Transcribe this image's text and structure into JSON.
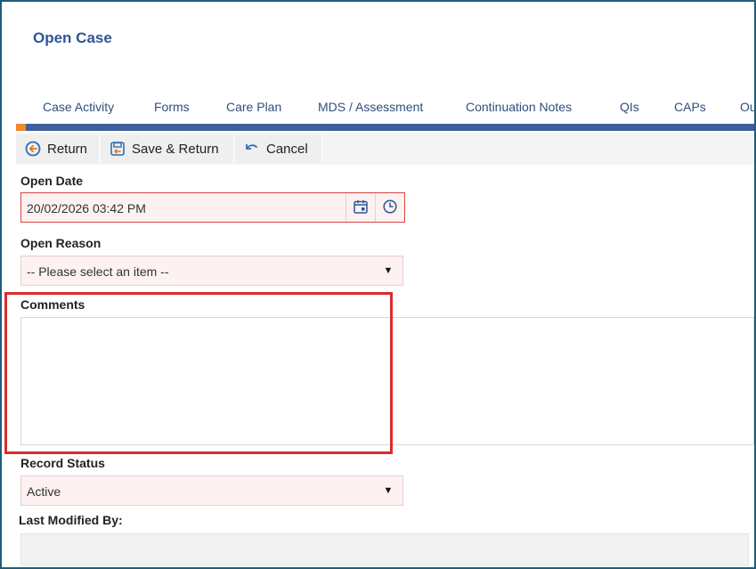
{
  "page": {
    "title": "Open Case"
  },
  "tabs": [
    {
      "label": "Case Activity"
    },
    {
      "label": "Forms"
    },
    {
      "label": "Care Plan"
    },
    {
      "label": "MDS / Assessment"
    },
    {
      "label": "Continuation Notes"
    },
    {
      "label": "QIs"
    },
    {
      "label": "CAPs"
    },
    {
      "label": "Ou"
    }
  ],
  "toolbar": {
    "return_label": "Return",
    "save_return_label": "Save & Return",
    "cancel_label": "Cancel"
  },
  "form": {
    "open_date": {
      "label": "Open Date",
      "value": "20/02/2026 03:42 PM"
    },
    "open_reason": {
      "label": "Open Reason",
      "value": "-- Please select an item --"
    },
    "comments": {
      "label": "Comments",
      "value": ""
    },
    "record_status": {
      "label": "Record Status",
      "value": "Active"
    },
    "last_modified_by": {
      "label": "Last Modified By:",
      "value": ""
    }
  },
  "colors": {
    "title": "#2f5596",
    "tab_bar": "#3e5f9a",
    "tab_accent": "#f08a2c",
    "required_field_bg": "#fdf1f1",
    "highlight_box": "#d92c2c"
  }
}
